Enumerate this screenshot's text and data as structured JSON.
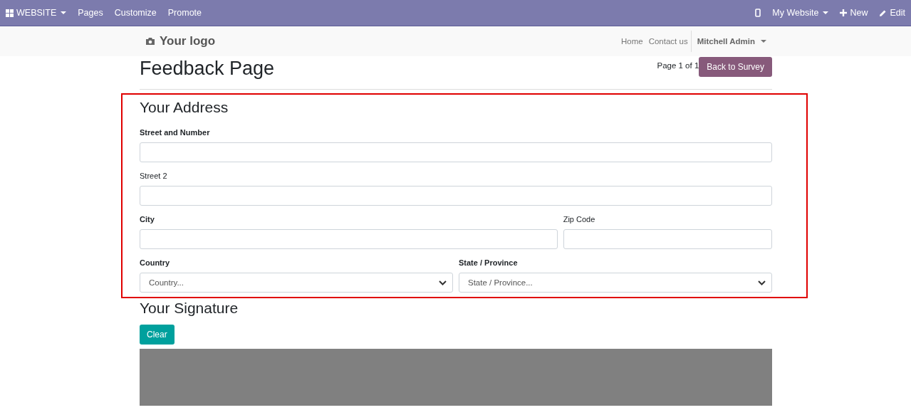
{
  "admin_bar": {
    "app_menu": "WEBSITE",
    "menu": [
      "Pages",
      "Customize",
      "Promote"
    ],
    "website_menu": "My Website",
    "new": "New",
    "edit": "Edit"
  },
  "navbar": {
    "logo": "Your logo",
    "links": [
      "Home",
      "Contact us"
    ],
    "user": "Mitchell Admin"
  },
  "page": {
    "title": "Feedback Page",
    "pager": "Page 1 of 1",
    "back_button": "Back to Survey"
  },
  "address": {
    "title": "Your Address",
    "highlighted": true,
    "rows": [
      [
        {
          "label": "Street and Number",
          "required": true,
          "kind": "text"
        }
      ],
      [
        {
          "label": "Street 2",
          "required": false,
          "kind": "text"
        }
      ],
      [
        {
          "label": "City",
          "required": true,
          "kind": "text"
        },
        {
          "label": "Zip Code",
          "required": false,
          "kind": "text"
        }
      ],
      [
        {
          "label": "Country",
          "required": true,
          "kind": "select",
          "placeholder": "Country..."
        },
        {
          "label": "State / Province",
          "required": true,
          "kind": "select",
          "placeholder": "State / Province..."
        }
      ]
    ]
  },
  "signature": {
    "title": "Your Signature",
    "clear": "Clear"
  }
}
